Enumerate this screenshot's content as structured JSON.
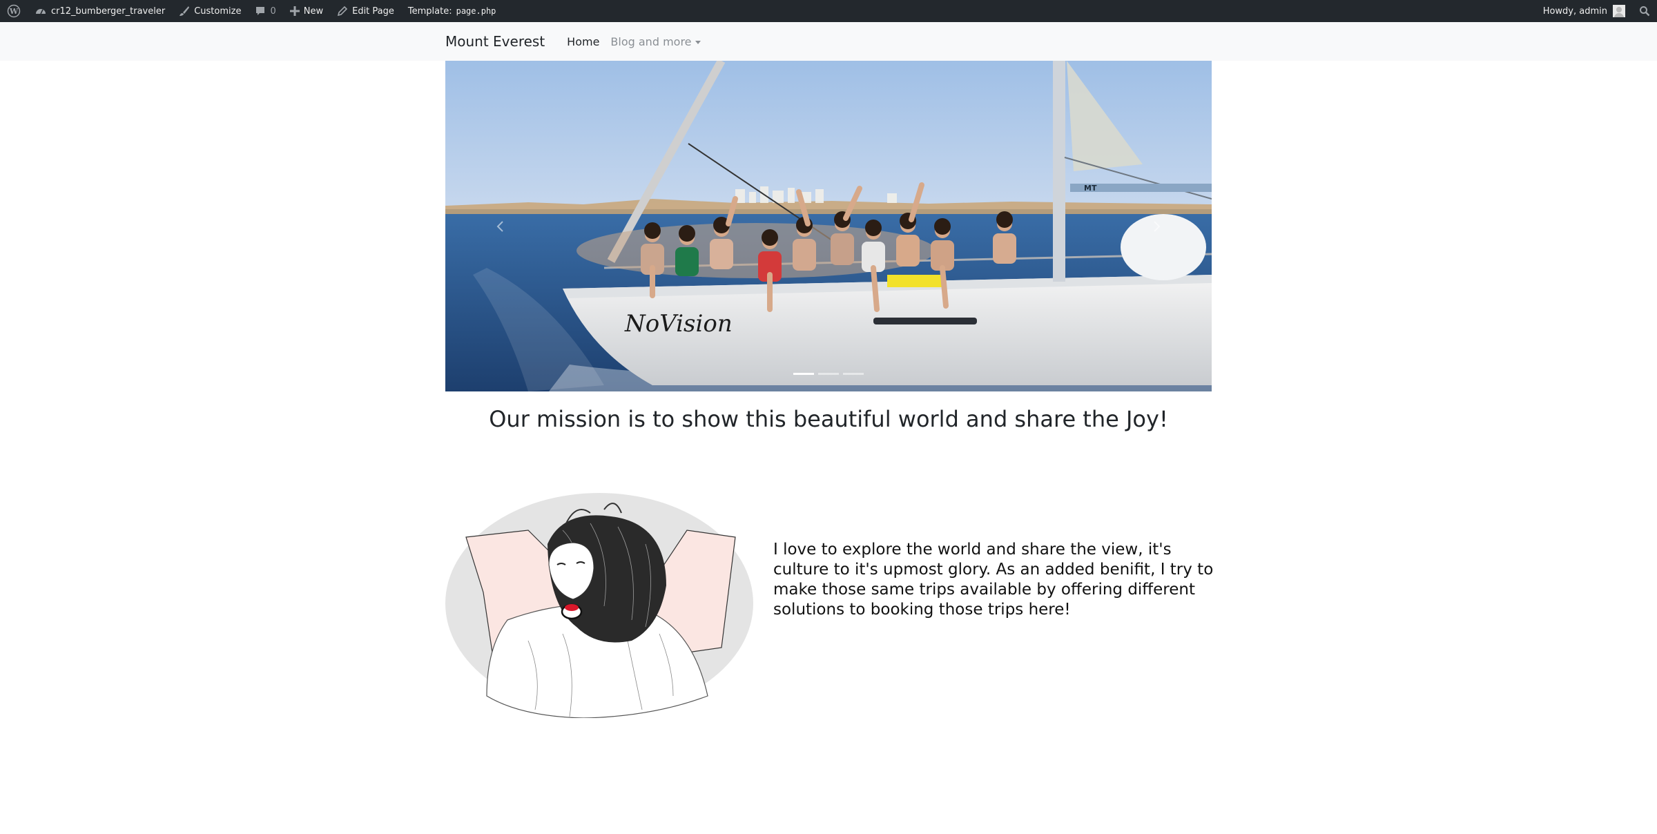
{
  "adminbar": {
    "site_name": "cr12_bumberger_traveler",
    "customize": "Customize",
    "comments_count": "0",
    "new": "New",
    "edit_page": "Edit Page",
    "template_label": "Template:",
    "template_file": "page.php",
    "howdy": "Howdy, admin",
    "colors": {
      "bg": "#23282d",
      "text": "#eeeeee"
    }
  },
  "navbar": {
    "brand": "Mount Everest",
    "links": [
      {
        "label": "Home",
        "active": true
      },
      {
        "label": "Blog and more",
        "dropdown": true
      }
    ]
  },
  "carousel": {
    "slide_count": 3,
    "active_index": 0,
    "boat_name": "NoVision",
    "mast_label": "MT"
  },
  "mission": {
    "heading": "Our mission is to show this beautiful world and share the Joy!"
  },
  "about": {
    "text": "I love to explore the world and share the view, it's culture to it's upmost glory. As an added benifit, I try to make those same trips available by offering different solutions to booking those trips here!"
  }
}
